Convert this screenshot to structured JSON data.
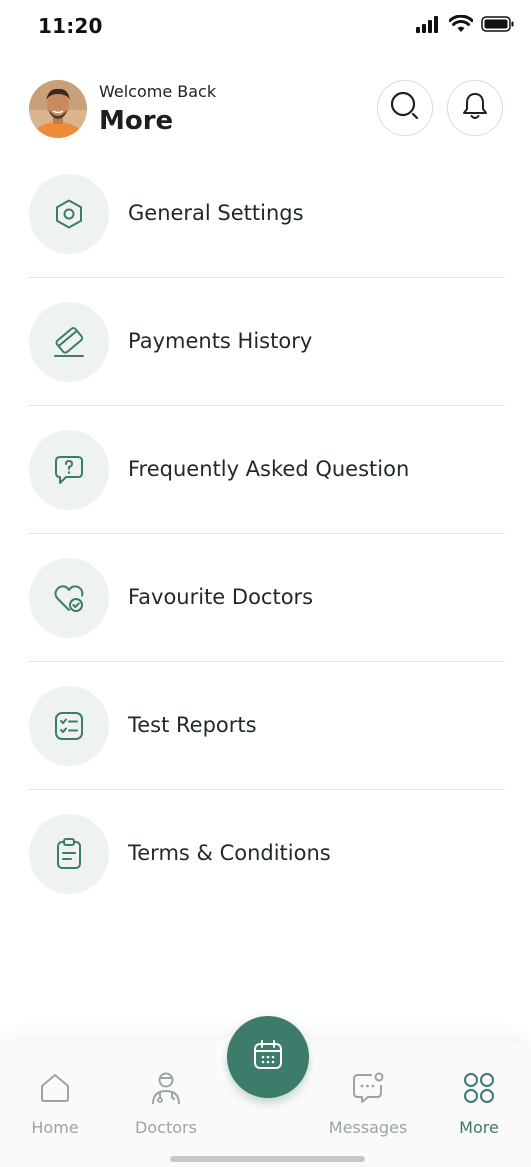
{
  "status_bar": {
    "time": "11:20"
  },
  "header": {
    "welcome": "Welcome Back",
    "title": "More"
  },
  "menu": {
    "items": [
      {
        "label": "General Settings",
        "icon": "settings-hex-icon"
      },
      {
        "label": "Payments History",
        "icon": "card-icon"
      },
      {
        "label": "Frequently Asked Question",
        "icon": "question-bubble-icon"
      },
      {
        "label": "Favourite Doctors",
        "icon": "heart-check-icon"
      },
      {
        "label": "Test Reports",
        "icon": "checklist-icon"
      },
      {
        "label": "Terms & Conditions",
        "icon": "clipboard-icon"
      }
    ]
  },
  "tabbar": {
    "tabs": [
      {
        "label": "Home",
        "icon": "home-icon",
        "active": false
      },
      {
        "label": "Doctors",
        "icon": "doctor-icon",
        "active": false
      },
      {
        "label": "Messages",
        "icon": "chat-icon",
        "active": false
      },
      {
        "label": "More",
        "icon": "grid-icon",
        "active": true
      }
    ],
    "center_action_icon": "calendar-icon"
  },
  "colors": {
    "accent": "#3d7b6a",
    "icon_bg": "#eef3f1",
    "inactive": "#9aa6a2"
  }
}
